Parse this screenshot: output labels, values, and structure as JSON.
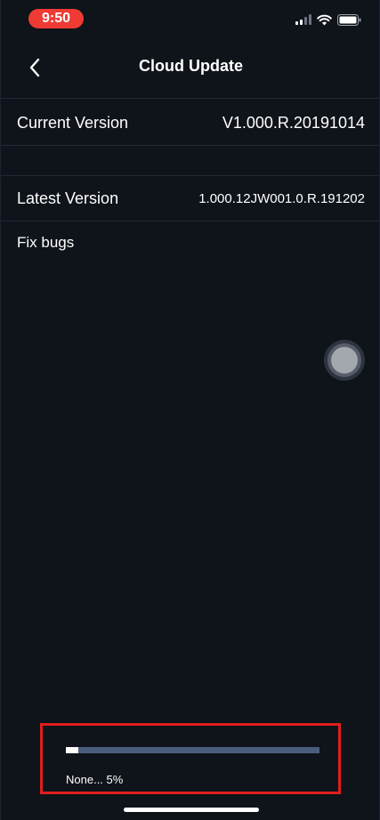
{
  "status_bar": {
    "time": "9:50",
    "icons": [
      "cellular-signal-icon",
      "wifi-icon",
      "battery-icon"
    ]
  },
  "nav": {
    "title": "Cloud Update",
    "back_icon": "chevron-left-icon"
  },
  "current_version": {
    "label": "Current Version",
    "value": "V1.000.R.20191014"
  },
  "latest_version": {
    "label": "Latest Version",
    "value": "1.000.12JW001.0.R.191202"
  },
  "release_notes": "Fix bugs",
  "progress": {
    "value_percent": 5,
    "text": "None... 5%"
  },
  "colors": {
    "background": "#0f131a",
    "divider": "#222a37",
    "status_time_pill": "#ef3b33",
    "progress_track": "#4a5d7c",
    "progress_fill": "#ffffff",
    "highlight_box": "#e01e1e"
  }
}
